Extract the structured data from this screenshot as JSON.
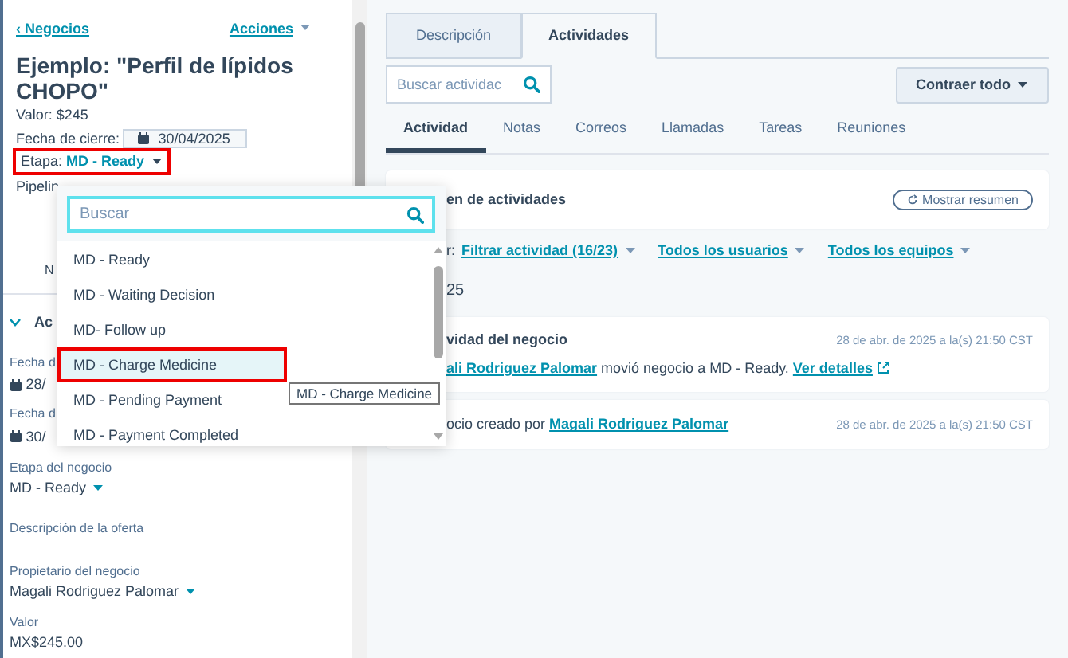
{
  "sidebar": {
    "back_link": "‹ Negocios",
    "actions": "Acciones",
    "title": "Ejemplo: \"Perfil de lípidos CHOPO\"",
    "value": "Valor: $245",
    "close_date_label": "Fecha de cierre:",
    "close_date": "30/04/2025",
    "stage_label": "Etapa:",
    "stage_value": "MD - Ready",
    "stage_highlighted": true,
    "pipeline_label": "Pipelin",
    "avatar_label": "N",
    "section_title": "Ac",
    "section_expanded": true,
    "fields": [
      {
        "kind": "date",
        "label": "Fecha d",
        "value": "28/"
      },
      {
        "kind": "date",
        "label": "Fecha d",
        "value": "30/"
      },
      {
        "kind": "select",
        "label": "Etapa del negocio",
        "value": "MD - Ready"
      },
      {
        "kind": "empty",
        "label": "Descripción de la oferta"
      },
      {
        "kind": "select",
        "label": "Propietario del negocio",
        "value": "Magali Rodriguez Palomar"
      },
      {
        "kind": "text",
        "label": "Valor",
        "value": "MX$245.00"
      }
    ]
  },
  "dropdown": {
    "placeholder": "Buscar",
    "items": [
      {
        "label": "MD - Ready",
        "selected": false,
        "highlighted": false
      },
      {
        "label": "MD - Waiting Decision",
        "selected": false,
        "highlighted": false
      },
      {
        "label": "MD- Follow up",
        "selected": false,
        "highlighted": false
      },
      {
        "label": "MD - Charge Medicine",
        "selected": true,
        "highlighted": true
      },
      {
        "label": "MD - Pending Payment",
        "selected": false,
        "highlighted": false
      },
      {
        "label": "MD - Payment Completed",
        "selected": false,
        "highlighted": false
      }
    ],
    "tooltip": "MD - Charge Medicine"
  },
  "main": {
    "tabs": [
      {
        "label": "Descripción",
        "selected": false
      },
      {
        "label": "Actividades",
        "selected": true
      }
    ],
    "search": {
      "placeholder": "Buscar actividac"
    },
    "collapse_button": "Contraer todo",
    "subtabs": [
      {
        "label": "Actividad",
        "selected": true
      },
      {
        "label": "Notas",
        "selected": false
      },
      {
        "label": "Correos",
        "selected": false
      },
      {
        "label": "Llamadas",
        "selected": false
      },
      {
        "label": "Tareas",
        "selected": false
      },
      {
        "label": "Reuniones",
        "selected": false
      }
    ],
    "summary": {
      "title": "en de actividades",
      "button": "Mostrar resumen"
    },
    "filters_prefix": "r:",
    "filters": [
      "Filtrar actividad (16/23)",
      "Todos los usuarios",
      "Todos los equipos"
    ],
    "date_heading": "25",
    "activities": [
      {
        "title": "vidad del negocio",
        "time": "28 de abr. de 2025 a la(s) 21:50 CST",
        "actor": "ali Rodriguez Palomar",
        "text": " movió negocio a MD - Ready. ",
        "link": "Ver detalles"
      },
      {
        "lead": "ocio creado por ",
        "actor": "Magali Rodriguez Palomar",
        "time": "28 de abr. de 2025 a la(s) 21:50 CST"
      }
    ]
  }
}
